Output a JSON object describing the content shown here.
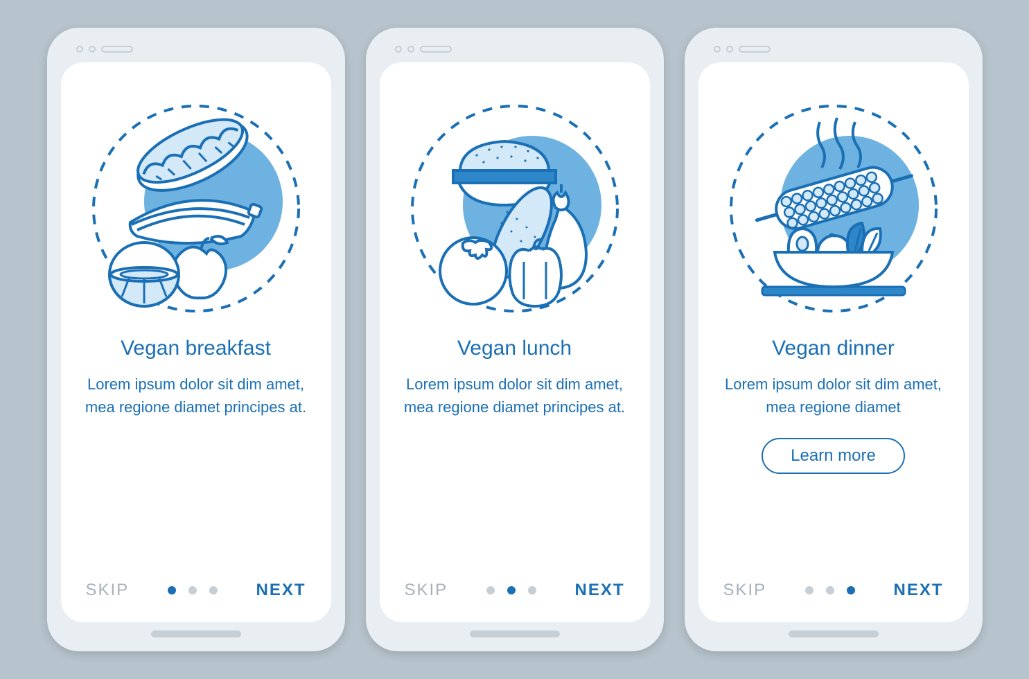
{
  "colors": {
    "accent": "#1a6fb5",
    "muted": "#a7b1bb",
    "dot_inactive": "#c6ced6"
  },
  "screens": [
    {
      "title": "Vegan breakfast",
      "desc": "Lorem ipsum dolor sit dim amet, mea regione diamet principes at.",
      "skip": "SKIP",
      "next": "NEXT",
      "active_dot": 0,
      "has_learn_more": false
    },
    {
      "title": "Vegan lunch",
      "desc": "Lorem ipsum dolor sit dim amet, mea regione diamet principes at.",
      "skip": "SKIP",
      "next": "NEXT",
      "active_dot": 1,
      "has_learn_more": false
    },
    {
      "title": "Vegan dinner",
      "desc": "Lorem ipsum dolor sit dim amet, mea regione diamet",
      "skip": "SKIP",
      "next": "NEXT",
      "active_dot": 2,
      "has_learn_more": true,
      "learn_more": "Learn more"
    }
  ]
}
